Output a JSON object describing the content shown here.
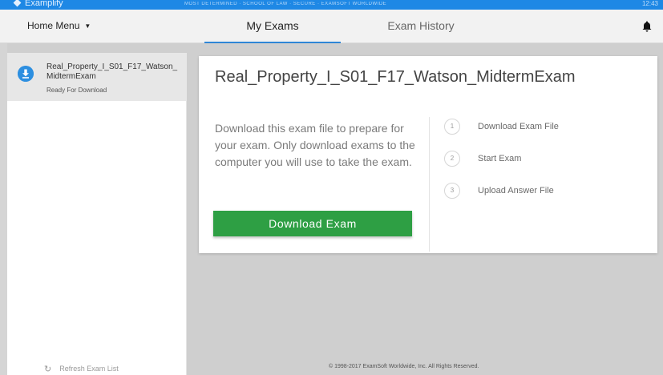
{
  "titlebar": {
    "app_name": "Examplify",
    "center_text": "MOST DETERMINED · SCHOOL OF LAW · SECURE · EXAMSOFT WORLDWIDE",
    "clock": "12:43"
  },
  "header": {
    "home_menu": "Home Menu",
    "tabs": [
      {
        "label": "My Exams"
      },
      {
        "label": "Exam History"
      }
    ]
  },
  "sidebar": {
    "exam": {
      "name": "Real_Property_I_S01_F17_Watson_MidtermExam",
      "status": "Ready For Download"
    },
    "refresh_label": "Refresh Exam List"
  },
  "card": {
    "title": "Real_Property_I_S01_F17_Watson_MidtermExam",
    "description": "Download this exam file to prepare for your exam. Only download exams to the computer you will use to take the exam.",
    "button_label": "Download Exam",
    "steps": [
      {
        "num": "1",
        "label": "Download Exam File"
      },
      {
        "num": "2",
        "label": "Start Exam"
      },
      {
        "num": "3",
        "label": "Upload Answer File"
      }
    ]
  },
  "footer": "© 1998-2017 ExamSoft Worldwide, Inc. All Rights Reserved.",
  "colors": {
    "accent_blue": "#2d8fe0",
    "download_green": "#2e9f44",
    "tab_underline": "#2f86d6"
  }
}
